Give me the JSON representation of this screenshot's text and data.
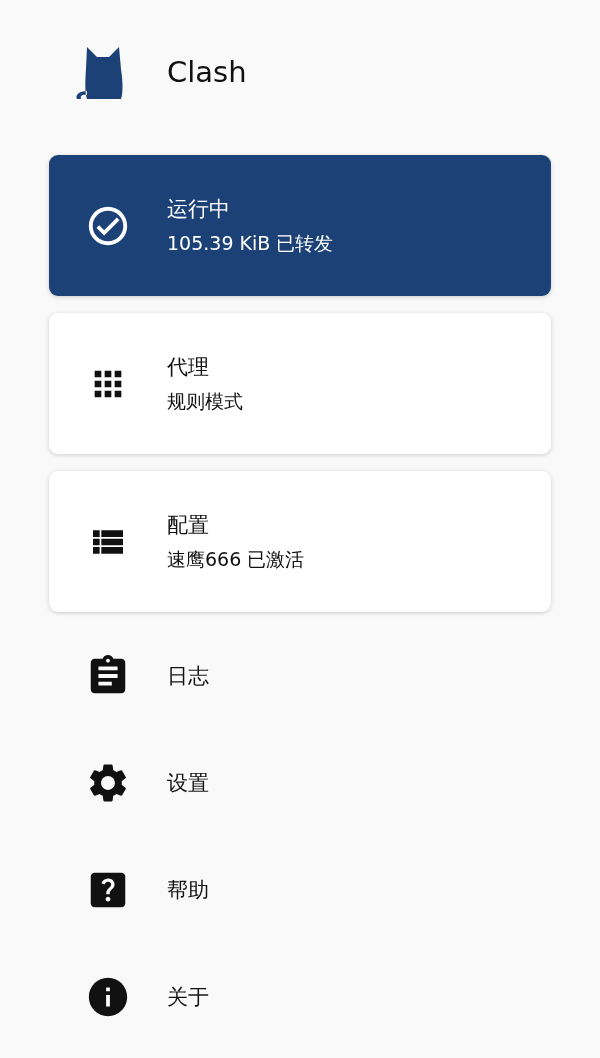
{
  "app": {
    "title": "Clash"
  },
  "cards": [
    {
      "kind": "status",
      "active": true,
      "title": "运行中",
      "subtitle": "105.39 KiB 已转发"
    },
    {
      "kind": "proxy",
      "active": false,
      "title": "代理",
      "subtitle": "规则模式"
    },
    {
      "kind": "profile",
      "active": false,
      "title": "配置",
      "subtitle": "速鹰666 已激活"
    }
  ],
  "menu": [
    {
      "kind": "logs",
      "label": "日志"
    },
    {
      "kind": "settings",
      "label": "设置"
    },
    {
      "kind": "help",
      "label": "帮助"
    },
    {
      "kind": "about",
      "label": "关于"
    }
  ]
}
